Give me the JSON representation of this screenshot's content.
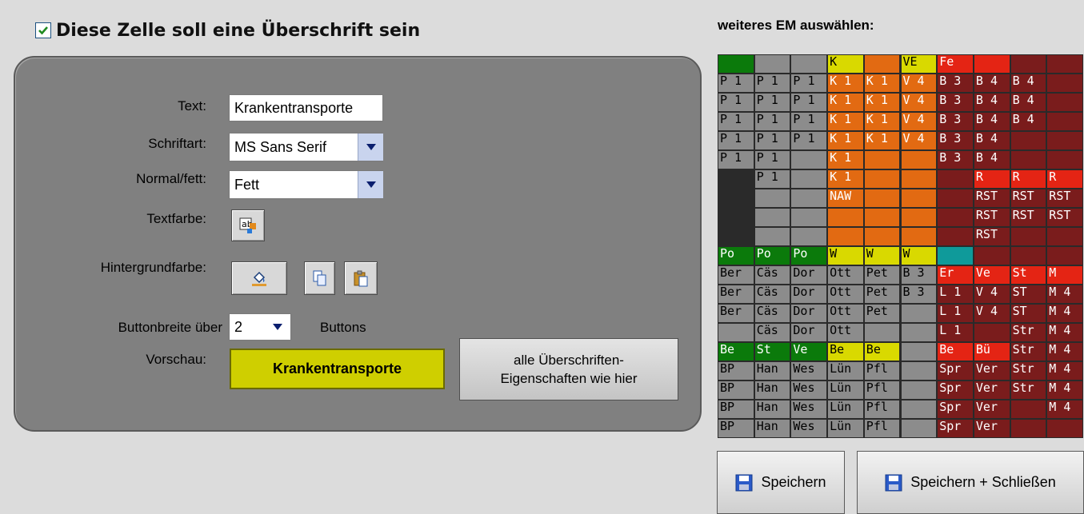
{
  "header": {
    "checkbox_checked": true,
    "label": "Diese Zelle soll eine Überschrift sein"
  },
  "form": {
    "text_label": "Text:",
    "text_value": "Krankentransporte",
    "font_label": "Schriftart:",
    "font_value": "MS Sans Serif",
    "weight_label": "Normal/fett:",
    "weight_value": "Fett",
    "textcolor_label": "Textfarbe:",
    "bgcolor_label": "Hintergrundfarbe:",
    "buttonwidth_label": "Buttonbreite über",
    "buttonwidth_value": "2",
    "buttonwidth_suffix": "Buttons",
    "preview_label": "Vorschau:",
    "preview_text": "Krankentransporte",
    "apply_all_line1": "alle Überschriften-",
    "apply_all_line2": "Eigenschaften wie hier"
  },
  "right": {
    "title": "weiteres EM auswählen:"
  },
  "colors": {
    "gray": "#8c8c8c",
    "green": "#0b7a0b",
    "yellow": "#d9d900",
    "orange": "#e26a12",
    "red": "#e42414",
    "maroon": "#7a1c1c",
    "teal": "#0f9a9a",
    "preview_bg": "#cfcf00"
  },
  "em_grid": [
    [
      [
        "",
        "green"
      ],
      [
        "P 1",
        "gray"
      ],
      [
        "P 1",
        "gray"
      ],
      [
        "P 1",
        "gray"
      ],
      [
        "P 1",
        "gray"
      ],
      [
        "P 1",
        "gray"
      ],
      [
        "",
        ""
      ],
      [
        "",
        ""
      ],
      [
        "",
        ""
      ],
      [
        "",
        ""
      ],
      [
        "Po",
        "green"
      ],
      [
        "Ber",
        "gray"
      ],
      [
        "Ber",
        "gray"
      ],
      [
        "Ber",
        "gray"
      ],
      [
        "",
        "gray"
      ],
      [
        "Be",
        "green"
      ],
      [
        "BP",
        "gray"
      ],
      [
        "BP",
        "gray"
      ],
      [
        "BP",
        "gray"
      ],
      [
        "BP",
        "gray"
      ]
    ],
    [
      [
        "",
        "gray"
      ],
      [
        "P 1",
        "gray"
      ],
      [
        "P 1",
        "gray"
      ],
      [
        "P 1",
        "gray"
      ],
      [
        "P 1",
        "gray"
      ],
      [
        "P 1",
        "gray"
      ],
      [
        "P 1",
        "gray"
      ],
      [
        "",
        "gray"
      ],
      [
        "",
        "gray"
      ],
      [
        "",
        "gray"
      ],
      [
        "Po",
        "green"
      ],
      [
        "Cäs",
        "gray"
      ],
      [
        "Cäs",
        "gray"
      ],
      [
        "Cäs",
        "gray"
      ],
      [
        "Cäs",
        "gray"
      ],
      [
        "St",
        "green"
      ],
      [
        "Han",
        "gray"
      ],
      [
        "Han",
        "gray"
      ],
      [
        "Han",
        "gray"
      ],
      [
        "Han",
        "gray"
      ]
    ],
    [
      [
        "",
        "gray"
      ],
      [
        "P 1",
        "gray"
      ],
      [
        "P 1",
        "gray"
      ],
      [
        "P 1",
        "gray"
      ],
      [
        "P 1",
        "gray"
      ],
      [
        "",
        "gray"
      ],
      [
        "",
        "gray"
      ],
      [
        "",
        "gray"
      ],
      [
        "",
        "gray"
      ],
      [
        "",
        "gray"
      ],
      [
        "Po",
        "green"
      ],
      [
        "Dor",
        "gray"
      ],
      [
        "Dor",
        "gray"
      ],
      [
        "Dor",
        "gray"
      ],
      [
        "Dor",
        "gray"
      ],
      [
        "Ve",
        "green"
      ],
      [
        "Wes",
        "gray"
      ],
      [
        "Wes",
        "gray"
      ],
      [
        "Wes",
        "gray"
      ],
      [
        "Wes",
        "gray"
      ]
    ],
    [
      [
        "K",
        "yellow"
      ],
      [
        "K 1",
        "orange"
      ],
      [
        "K 1",
        "orange"
      ],
      [
        "K 1",
        "orange"
      ],
      [
        "K 1",
        "orange"
      ],
      [
        "K 1",
        "orange"
      ],
      [
        "K 1",
        "orange"
      ],
      [
        "NAW",
        "orange"
      ],
      [
        "",
        "orange"
      ],
      [
        "",
        "orange"
      ],
      [
        "W",
        "yellow"
      ],
      [
        "Ott",
        "gray"
      ],
      [
        "Ott",
        "gray"
      ],
      [
        "Ott",
        "gray"
      ],
      [
        "Ott",
        "gray"
      ],
      [
        "Be",
        "yellow"
      ],
      [
        "Lün",
        "gray"
      ],
      [
        "Lün",
        "gray"
      ],
      [
        "Lün",
        "gray"
      ],
      [
        "Lün",
        "gray"
      ]
    ],
    [
      [
        "",
        "orange"
      ],
      [
        "K 1",
        "orange"
      ],
      [
        "K 1",
        "orange"
      ],
      [
        "K 1",
        "orange"
      ],
      [
        "K 1",
        "orange"
      ],
      [
        "",
        "orange"
      ],
      [
        "",
        "orange"
      ],
      [
        "",
        "orange"
      ],
      [
        "",
        "orange"
      ],
      [
        "",
        "orange"
      ],
      [
        "W",
        "yellow"
      ],
      [
        "Pet",
        "gray"
      ],
      [
        "Pet",
        "gray"
      ],
      [
        "Pet",
        "gray"
      ],
      [
        "",
        "gray"
      ],
      [
        "Be",
        "yellow"
      ],
      [
        "Pfl",
        "gray"
      ],
      [
        "Pfl",
        "gray"
      ],
      [
        "Pfl",
        "gray"
      ],
      [
        "Pfl",
        "gray"
      ]
    ],
    [
      [
        "VE",
        "yellow"
      ],
      [
        "V 4",
        "orange"
      ],
      [
        "V 4",
        "orange"
      ],
      [
        "V 4",
        "orange"
      ],
      [
        "V 4",
        "orange"
      ],
      [
        "",
        "orange"
      ],
      [
        "",
        "orange"
      ],
      [
        "",
        "orange"
      ],
      [
        "",
        "orange"
      ],
      [
        "",
        "orange"
      ],
      [
        "W",
        "yellow"
      ],
      [
        "B 3",
        "gray"
      ],
      [
        "B 3",
        "gray"
      ],
      [
        "",
        "gray"
      ],
      [
        "",
        "gray"
      ],
      [
        "",
        "gray"
      ],
      [
        "",
        "gray"
      ],
      [
        "",
        "gray"
      ],
      [
        "",
        "gray"
      ],
      [
        "",
        "gray"
      ]
    ],
    [
      [
        "Fe",
        "red"
      ],
      [
        "B 3",
        "maroon"
      ],
      [
        "B 3",
        "maroon"
      ],
      [
        "B 3",
        "maroon"
      ],
      [
        "B 3",
        "maroon"
      ],
      [
        "B 3",
        "maroon"
      ],
      [
        "",
        "maroon"
      ],
      [
        "",
        "maroon"
      ],
      [
        "",
        "maroon"
      ],
      [
        "",
        "maroon"
      ],
      [
        "",
        "teal"
      ],
      [
        "Er",
        "red"
      ],
      [
        "L 1",
        "maroon"
      ],
      [
        "L 1",
        "maroon"
      ],
      [
        "L 1",
        "maroon"
      ],
      [
        "Be",
        "red"
      ],
      [
        "Spr",
        "maroon"
      ],
      [
        "Spr",
        "maroon"
      ],
      [
        "Spr",
        "maroon"
      ],
      [
        "Spr",
        "maroon"
      ]
    ],
    [
      [
        "",
        "red"
      ],
      [
        "B 4",
        "maroon"
      ],
      [
        "B 4",
        "maroon"
      ],
      [
        "B 4",
        "maroon"
      ],
      [
        "B 4",
        "maroon"
      ],
      [
        "B 4",
        "maroon"
      ],
      [
        "R",
        "red"
      ],
      [
        "RST",
        "maroon"
      ],
      [
        "RST",
        "maroon"
      ],
      [
        "RST",
        "maroon"
      ],
      [
        "",
        "maroon"
      ],
      [
        "Ve",
        "red"
      ],
      [
        "V 4",
        "maroon"
      ],
      [
        "V 4",
        "maroon"
      ],
      [
        "",
        "maroon"
      ],
      [
        "Bü",
        "red"
      ],
      [
        "Ver",
        "maroon"
      ],
      [
        "Ver",
        "maroon"
      ],
      [
        "Ver",
        "maroon"
      ],
      [
        "Ver",
        "maroon"
      ]
    ],
    [
      [
        "",
        "maroon"
      ],
      [
        "B 4",
        "maroon"
      ],
      [
        "B 4",
        "maroon"
      ],
      [
        "B 4",
        "maroon"
      ],
      [
        "",
        "maroon"
      ],
      [
        "",
        "maroon"
      ],
      [
        "R",
        "red"
      ],
      [
        "RST",
        "maroon"
      ],
      [
        "RST",
        "maroon"
      ],
      [
        "",
        "maroon"
      ],
      [
        "",
        "maroon"
      ],
      [
        "St",
        "red"
      ],
      [
        "ST",
        "maroon"
      ],
      [
        "ST",
        "maroon"
      ],
      [
        "Str",
        "maroon"
      ],
      [
        "Str",
        "maroon"
      ],
      [
        "Str",
        "maroon"
      ],
      [
        "Str",
        "maroon"
      ],
      [
        "",
        "maroon"
      ],
      [
        "",
        "maroon"
      ]
    ],
    [
      [
        "",
        "maroon"
      ],
      [
        "",
        "maroon"
      ],
      [
        "",
        "maroon"
      ],
      [
        "",
        "maroon"
      ],
      [
        "",
        "maroon"
      ],
      [
        "",
        "maroon"
      ],
      [
        "R",
        "red"
      ],
      [
        "RST",
        "maroon"
      ],
      [
        "RST",
        "maroon"
      ],
      [
        "",
        "maroon"
      ],
      [
        "",
        "maroon"
      ],
      [
        "M",
        "red"
      ],
      [
        "M 4",
        "maroon"
      ],
      [
        "M 4",
        "maroon"
      ],
      [
        "M 4",
        "maroon"
      ],
      [
        "M 4",
        "maroon"
      ],
      [
        "M 4",
        "maroon"
      ],
      [
        "M 4",
        "maroon"
      ],
      [
        "M 4",
        "maroon"
      ],
      [
        "",
        "maroon"
      ]
    ]
  ],
  "buttons": {
    "save": "Speichern",
    "save_close": "Speichern + Schließen"
  }
}
